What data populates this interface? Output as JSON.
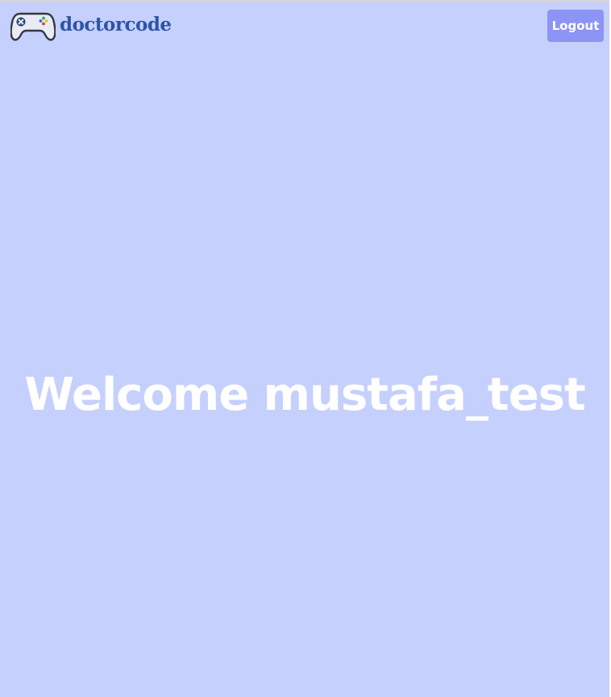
{
  "header": {
    "brand_name": "doctorcode",
    "brand_logo_icon": "gamepad-icon",
    "logout_label": "Logout"
  },
  "main": {
    "welcome_text": "Welcome mustafa_test"
  },
  "colors": {
    "page_background": "#c6d0fd",
    "brand_text": "#2e55a6",
    "logout_button": "#8c94f5",
    "welcome_text": "#ffffff"
  }
}
